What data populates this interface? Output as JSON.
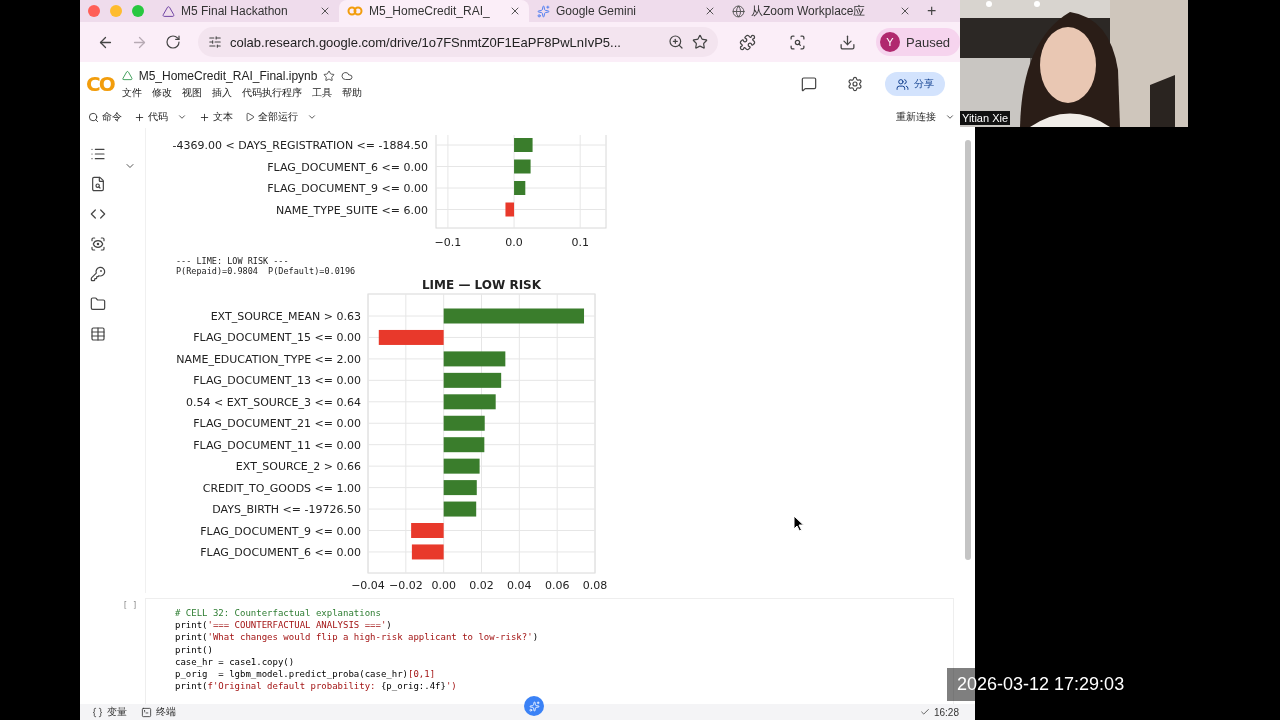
{
  "browser": {
    "tabs": [
      {
        "label": "M5 Final Hackathon",
        "kind": "page",
        "selected": false
      },
      {
        "label": "M5_HomeCredit_RAI_",
        "kind": "colab",
        "selected": true
      },
      {
        "label": "Google Gemini",
        "kind": "gemini",
        "selected": false
      },
      {
        "label": "从Zoom Workplace应",
        "kind": "zoom",
        "selected": false
      }
    ],
    "new_tab": "+",
    "forward_disabled": true,
    "address": "colab.research.google.com/drive/1o7FSnmtZ0F1EaPF8PwLnIvP5...",
    "profile": {
      "initial": "Y",
      "label": "Paused"
    }
  },
  "notebook": {
    "logo": "CO",
    "title": "M5_HomeCredit_RAI_Final.ipynb",
    "menu": [
      "文件",
      "修改",
      "视图",
      "插入",
      "代码执行程序",
      "工具",
      "帮助"
    ],
    "share": "分享",
    "toolbar": [
      {
        "label": "命令",
        "kind": "search",
        "dropdown": false
      },
      {
        "label": "代码",
        "kind": "add",
        "dropdown": true
      },
      {
        "label": "文本",
        "kind": "add",
        "dropdown": false
      },
      {
        "label": "全部运行",
        "kind": "run",
        "dropdown": true
      }
    ],
    "reconnect": "重新连接"
  },
  "output": {
    "chart_top": {
      "chart_data": {
        "type": "bar",
        "orientation": "horizontal",
        "grid": true,
        "categories": [
          "-4369.00 < DAYS_REGISTRATION <= -1884.50",
          "FLAG_DOCUMENT_6 <= 0.00",
          "FLAG_DOCUMENT_9 <= 0.00",
          "NAME_TYPE_SUITE <= 6.00"
        ],
        "series": [
          {
            "color": "#3a7d2c",
            "values": [
              0.028,
              0.025,
              0.017,
              null
            ]
          },
          {
            "color": "#e8392b",
            "values": [
              null,
              null,
              null,
              -0.013
            ]
          }
        ],
        "xlim": [
          -0.118,
          0.139
        ],
        "xticks": [
          {
            "value": -0.1,
            "label": "−0.1"
          },
          {
            "value": 0,
            "label": "0.0"
          },
          {
            "value": 0.1,
            "label": "0.1"
          }
        ]
      }
    },
    "log": [
      "--- LIME: LOW RISK ---",
      "P(Repaid)=0.9804  P(Default)=0.0196"
    ],
    "chart_low": {
      "chart_data": {
        "type": "bar",
        "orientation": "horizontal",
        "grid": true,
        "title": "LIME — LOW RISK",
        "categories": [
          "EXT_SOURCE_MEAN > 0.63",
          "FLAG_DOCUMENT_15 <= 0.00",
          "NAME_EDUCATION_TYPE <= 2.00",
          "FLAG_DOCUMENT_13 <= 0.00",
          "0.54 < EXT_SOURCE_3 <= 0.64",
          "FLAG_DOCUMENT_21 <= 0.00",
          "FLAG_DOCUMENT_11 <= 0.00",
          "EXT_SOURCE_2 > 0.66",
          "CREDIT_TO_GOODS <= 1.00",
          "DAYS_BIRTH <= -19726.50",
          "FLAG_DOCUMENT_9 <= 0.00",
          "FLAG_DOCUMENT_6 <= 0.00"
        ],
        "series": [
          {
            "color": "#3a7d2c",
            "values": [
              0.0742,
              null,
              0.0326,
              0.0304,
              0.0275,
              0.0217,
              0.0215,
              0.019,
              0.0175,
              0.0172,
              null,
              null
            ]
          },
          {
            "color": "#e8392b",
            "values": [
              null,
              -0.0343,
              null,
              null,
              null,
              null,
              null,
              null,
              null,
              null,
              -0.0172,
              -0.0168
            ]
          }
        ],
        "xlim": [
          -0.04,
          0.08
        ],
        "xticks": [
          {
            "value": -0.04,
            "label": "−0.04"
          },
          {
            "value": -0.02,
            "label": "−0.02"
          },
          {
            "value": 0,
            "label": "0.00"
          },
          {
            "value": 0.02,
            "label": "0.02"
          },
          {
            "value": 0.04,
            "label": "0.04"
          },
          {
            "value": 0.06,
            "label": "0.06"
          },
          {
            "value": 0.08,
            "label": "0.08"
          }
        ]
      }
    }
  },
  "code_cell": {
    "run_label": "[ ]",
    "lines": [
      [
        {
          "text": "# CELL 32: Counterfactual explanations",
          "kind": "comment"
        }
      ],
      [
        {
          "text": "print(",
          "kind": "plain"
        },
        {
          "text": "'=== COUNTERFACTUAL ANALYSIS ==='",
          "kind": "string"
        },
        {
          "text": ")",
          "kind": "plain"
        }
      ],
      [
        {
          "text": "print(",
          "kind": "plain"
        },
        {
          "text": "'What changes would flip a high-risk applicant to low-risk?'",
          "kind": "string"
        },
        {
          "text": ")",
          "kind": "plain"
        }
      ],
      [
        {
          "text": "print()",
          "kind": "plain"
        }
      ],
      [
        {
          "text": "case_hr = case1.copy()",
          "kind": "plain"
        }
      ],
      [
        {
          "text": "p_orig  = lgbm_model.predict_proba(case_hr)",
          "kind": "plain"
        },
        {
          "text": "[0,1]",
          "kind": "number"
        }
      ],
      [
        {
          "text": "print(",
          "kind": "plain"
        },
        {
          "text": "f'Original default probability: ",
          "kind": "string"
        },
        {
          "text": "{p_orig:.4f}",
          "kind": "plain"
        },
        {
          "text": "')",
          "kind": "string"
        }
      ]
    ]
  },
  "status_bar": {
    "variables": "变量",
    "terminal": "终端",
    "time": "16:28"
  },
  "meeting": {
    "participant": "Yitian Xie",
    "timestamp": "2026-03-12 17:29:03"
  }
}
